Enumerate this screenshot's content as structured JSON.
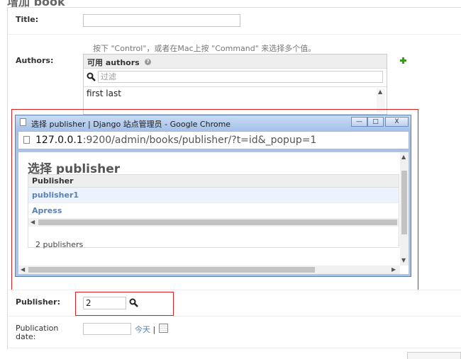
{
  "page": {
    "heading": "增加 book"
  },
  "form": {
    "title": {
      "label": "Title:",
      "value": ""
    },
    "authors": {
      "label": "Authors:",
      "help_text": "按下 \"Control\"，或者在Mac上按 \"Command\" 来选择多个值。",
      "available_title": "可用 authors",
      "filter_placeholder": "过滤",
      "options": [
        "first last"
      ]
    },
    "publisher": {
      "label": "Publisher:",
      "value": "2"
    },
    "publication_date": {
      "label_line1": "Publication",
      "label_line2": "date:",
      "value": "",
      "today_label": "今天",
      "separator": "|"
    }
  },
  "popup": {
    "window_title": "选择 publisher | Django 站点管理员 - Google Chrome",
    "url_host": "127.0.0.1",
    "url_rest": ":9200/admin/books/publisher/?t=id&_popup=1",
    "heading": "选择 publisher",
    "column_header": "Publisher",
    "rows": [
      "publisher1",
      "Apress"
    ],
    "count_text": "2 publishers",
    "controls": {
      "minimize": "—",
      "maximize": "□",
      "close": "X"
    }
  },
  "icons": {
    "filter": "search-icon",
    "add_author": "plus-icon",
    "lookup": "search-icon",
    "calendar": "calendar-icon",
    "page": "page-icon"
  },
  "colors": {
    "highlight_box": "#e02020",
    "link": "#5b80b2",
    "add_icon": "#3a9a1f"
  }
}
